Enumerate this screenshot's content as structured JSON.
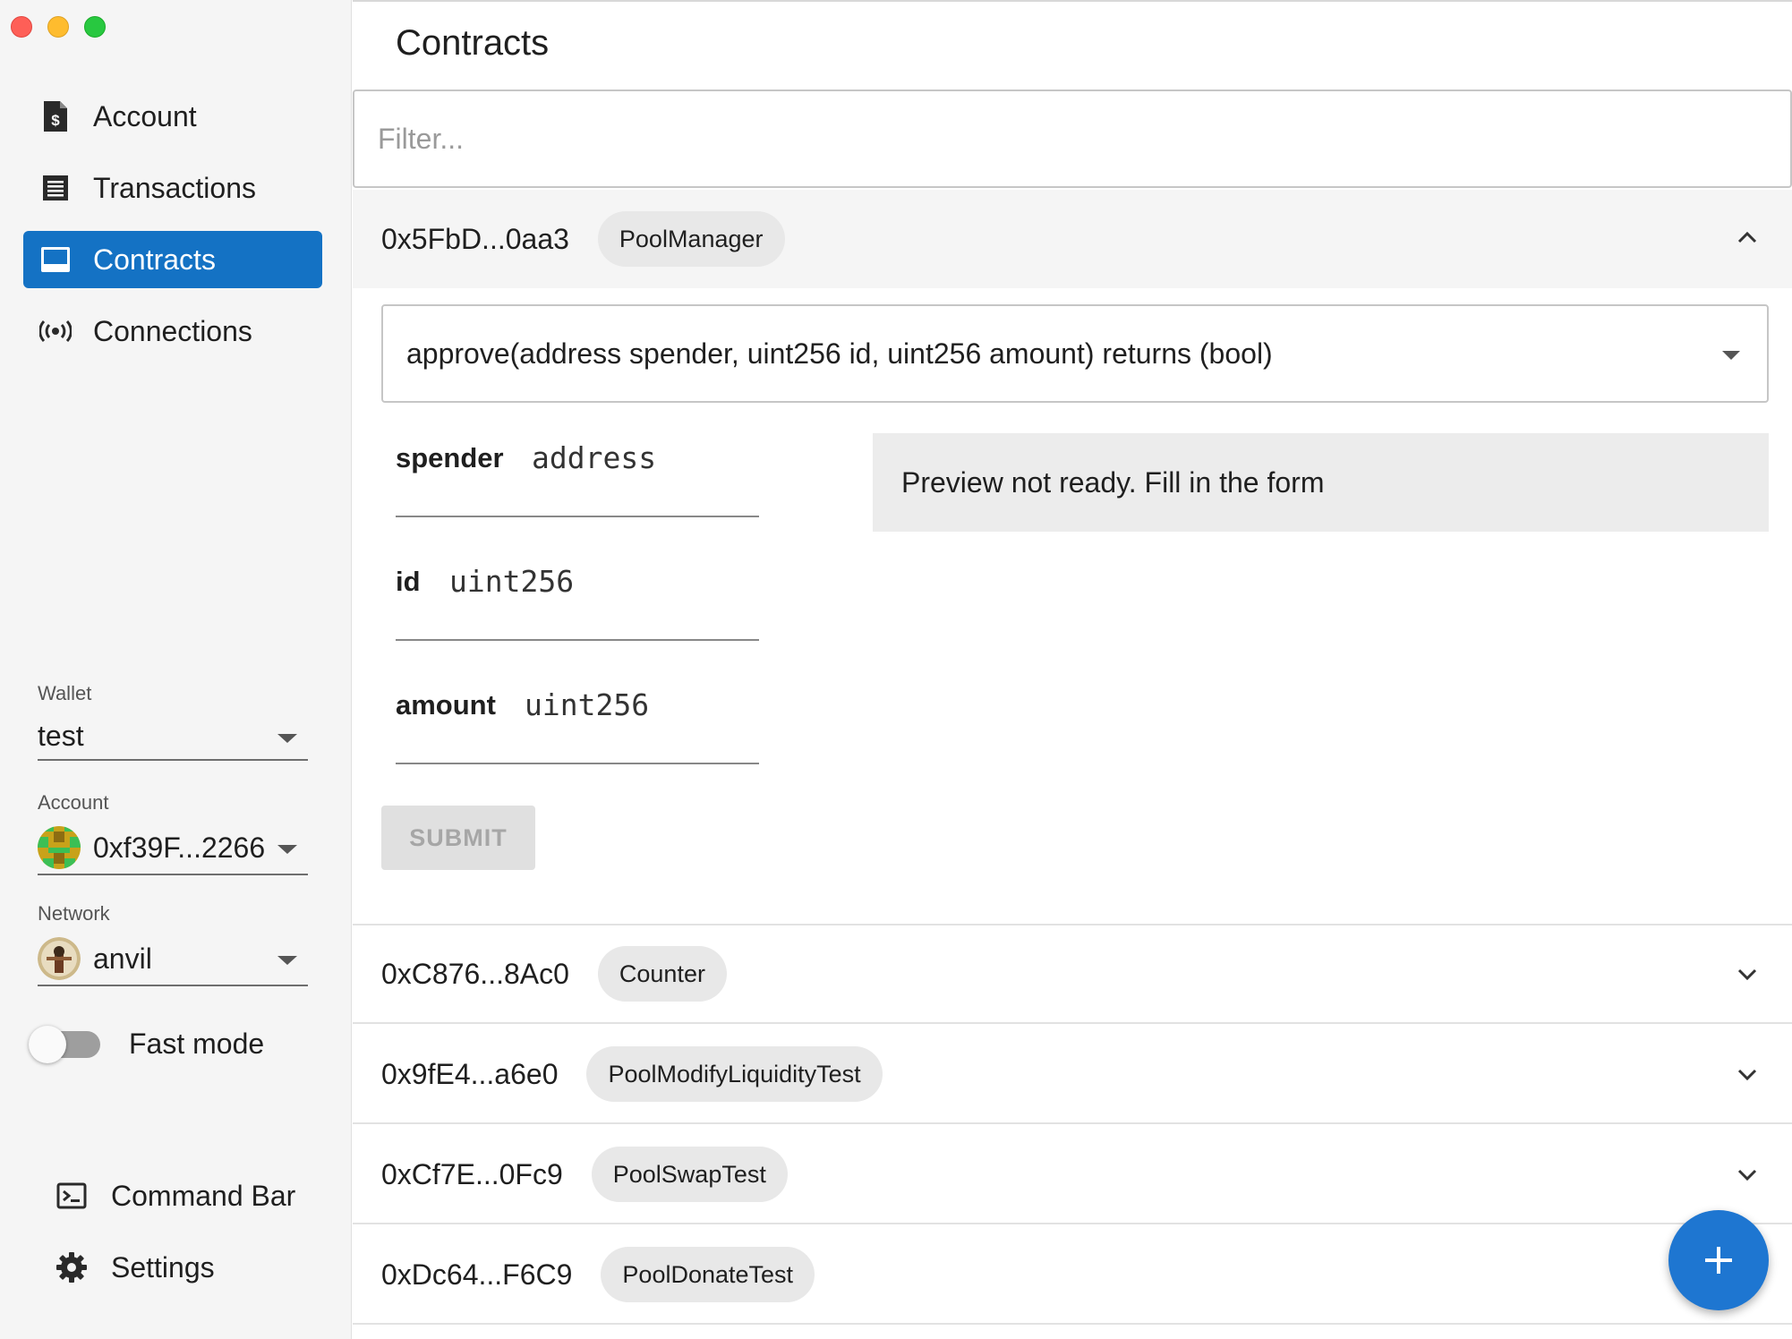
{
  "window": {
    "controls": [
      "close",
      "minimize",
      "zoom"
    ]
  },
  "sidebar": {
    "nav": [
      {
        "label": "Account",
        "icon": "document-dollar-icon",
        "active": false
      },
      {
        "label": "Transactions",
        "icon": "receipt-list-icon",
        "active": false
      },
      {
        "label": "Contracts",
        "icon": "contract-window-icon",
        "active": true
      },
      {
        "label": "Connections",
        "icon": "broadcast-icon",
        "active": false
      }
    ],
    "wallet": {
      "label": "Wallet",
      "value": "test"
    },
    "account": {
      "label": "Account",
      "value": "0xf39F...2266"
    },
    "network": {
      "label": "Network",
      "value": "anvil"
    },
    "fast_mode": {
      "label": "Fast mode",
      "enabled": false
    },
    "bottom": [
      {
        "label": "Command Bar",
        "icon": "terminal-icon"
      },
      {
        "label": "Settings",
        "icon": "gear-icon"
      }
    ]
  },
  "main": {
    "title": "Contracts",
    "filter": {
      "placeholder": "Filter...",
      "value": ""
    },
    "contracts": [
      {
        "address": "0x5FbD...0aa3",
        "name": "PoolManager",
        "expanded": true
      },
      {
        "address": "0xC876...8Ac0",
        "name": "Counter",
        "expanded": false
      },
      {
        "address": "0x9fE4...a6e0",
        "name": "PoolModifyLiquidityTest",
        "expanded": false
      },
      {
        "address": "0xCf7E...0Fc9",
        "name": "PoolSwapTest",
        "expanded": false
      },
      {
        "address": "0xDc64...F6C9",
        "name": "PoolDonateTest",
        "expanded": false
      }
    ],
    "expanded": {
      "function_signature": "approve(address spender, uint256 id, uint256 amount) returns (bool)",
      "params": [
        {
          "name": "spender",
          "type": "address",
          "value": ""
        },
        {
          "name": "id",
          "type": "uint256",
          "value": ""
        },
        {
          "name": "amount",
          "type": "uint256",
          "value": ""
        }
      ],
      "preview_text": "Preview not ready. Fill in the form",
      "submit_label": "SUBMIT"
    },
    "fab_icon": "plus-icon"
  },
  "colors": {
    "accent": "#1472c4",
    "fab": "#1e76d1",
    "sidebar_bg": "#f5f5f5",
    "chip_bg": "#e8e8e8"
  }
}
